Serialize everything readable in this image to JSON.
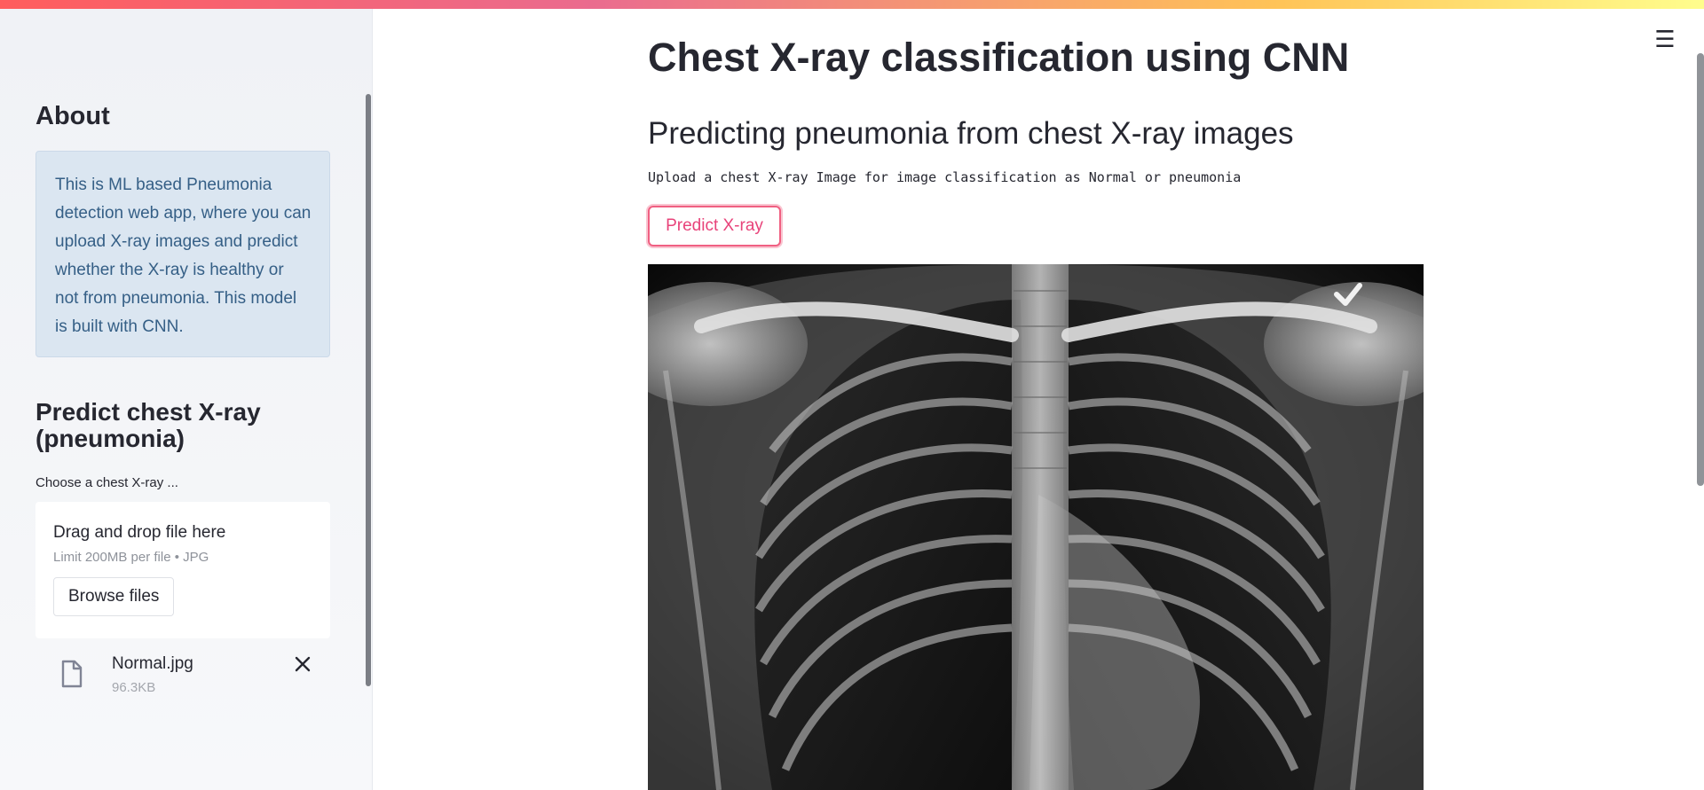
{
  "sidebar": {
    "about_title": "About",
    "about_text": "This is ML based Pneumonia detection web app, where you can upload X-ray images and predict whether the X-ray is healthy or not from pneumonia. This model is built with CNN.",
    "predict_title": "Predict chest X-ray (pneumonia)",
    "uploader": {
      "label": "Choose a chest X-ray ...",
      "drop_text": "Drag and drop file here",
      "limit_text": "Limit 200MB per file • JPG",
      "browse_label": "Browse files"
    },
    "uploaded_file": {
      "name": "Normal.jpg",
      "size": "96.3KB",
      "icon": "file-icon",
      "remove_icon": "close-icon"
    }
  },
  "main": {
    "title": "Chest X-ray classification using CNN",
    "subtitle": "Predicting pneumonia from chest X-ray images",
    "description": "Upload a chest X-ray Image for image classification as Normal or pneumonia",
    "predict_button": "Predict X-ray",
    "image_alt": "chest X-ray image"
  },
  "menu_icon": "hamburger-menu-icon",
  "colors": {
    "accent": "#e8437a",
    "info_bg": "#dbe6f1",
    "info_text": "#355f86"
  }
}
